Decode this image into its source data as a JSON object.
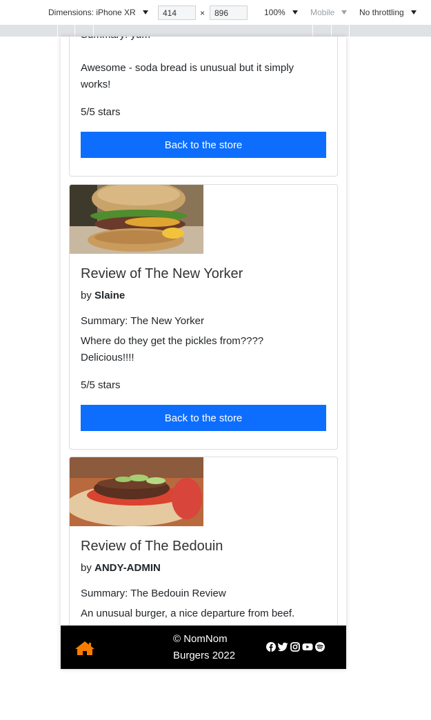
{
  "devtools": {
    "dimensions_label": "Dimensions: iPhone XR",
    "width": "414",
    "height": "896",
    "times": "×",
    "zoom": "100%",
    "mode": "Mobile",
    "throttling": "No throttling"
  },
  "reviews": [
    {
      "summary": "Summary: yum",
      "text": "Awesome - soda bread is unusual but it simply works!",
      "rating": "5/5 stars",
      "button": "Back to the store"
    },
    {
      "title": "Review of The New Yorker",
      "by": "by",
      "author": "Slaine",
      "summary": "Summary: The New Yorker",
      "text": "Where do they get the pickles from???? Delicious!!!!",
      "rating": "5/5 stars",
      "button": "Back to the store"
    },
    {
      "title": "Review of The Bedouin",
      "by": "by",
      "author": "ANDY-ADMIN",
      "summary": "Summary: The Bedouin Review",
      "text": "An unusual burger, a nice departure from beef."
    }
  ],
  "footer": {
    "copyright": "© NomNom Burgers 2022",
    "home_icon": "home-icon",
    "social_icons": [
      "facebook-icon",
      "twitter-icon",
      "instagram-icon",
      "youtube-icon",
      "spotify-icon"
    ]
  },
  "colors": {
    "primary": "#0d6efd",
    "footer_bg": "#000000",
    "home_icon": "#f57c00"
  }
}
